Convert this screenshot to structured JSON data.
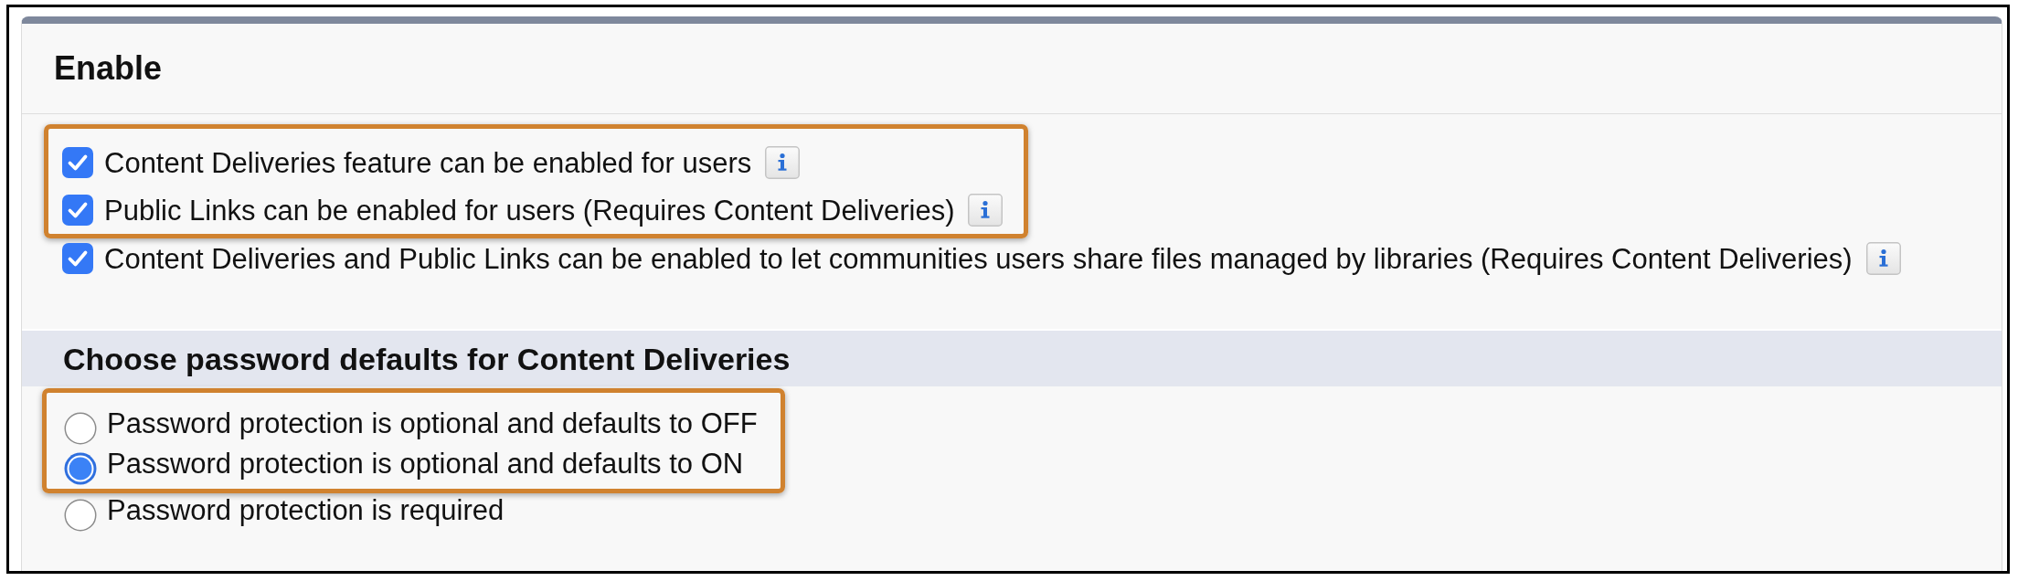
{
  "panel": {
    "title": "Enable",
    "checkbox_groups": [
      {
        "highlighted": true,
        "items": [
          {
            "label": "Content Deliveries feature can be enabled for users",
            "checked": true,
            "info": true
          },
          {
            "label": "Public Links can be enabled for users (Requires Content Deliveries)",
            "checked": true,
            "info": true
          }
        ]
      },
      {
        "highlighted": false,
        "items": [
          {
            "label": "Content Deliveries and Public Links can be enabled to let communities users share files managed by libraries (Requires Content Deliveries)",
            "checked": true,
            "info": true
          }
        ]
      }
    ],
    "password_section": {
      "title": "Choose password defaults for Content Deliveries",
      "radio_groups": [
        {
          "highlighted": true,
          "items": [
            {
              "label": "Password protection is optional and defaults to OFF",
              "selected": false
            },
            {
              "label": "Password protection is optional and defaults to ON",
              "selected": true
            }
          ]
        },
        {
          "highlighted": false,
          "items": [
            {
              "label": "Password protection is required",
              "selected": false
            }
          ]
        }
      ]
    }
  }
}
